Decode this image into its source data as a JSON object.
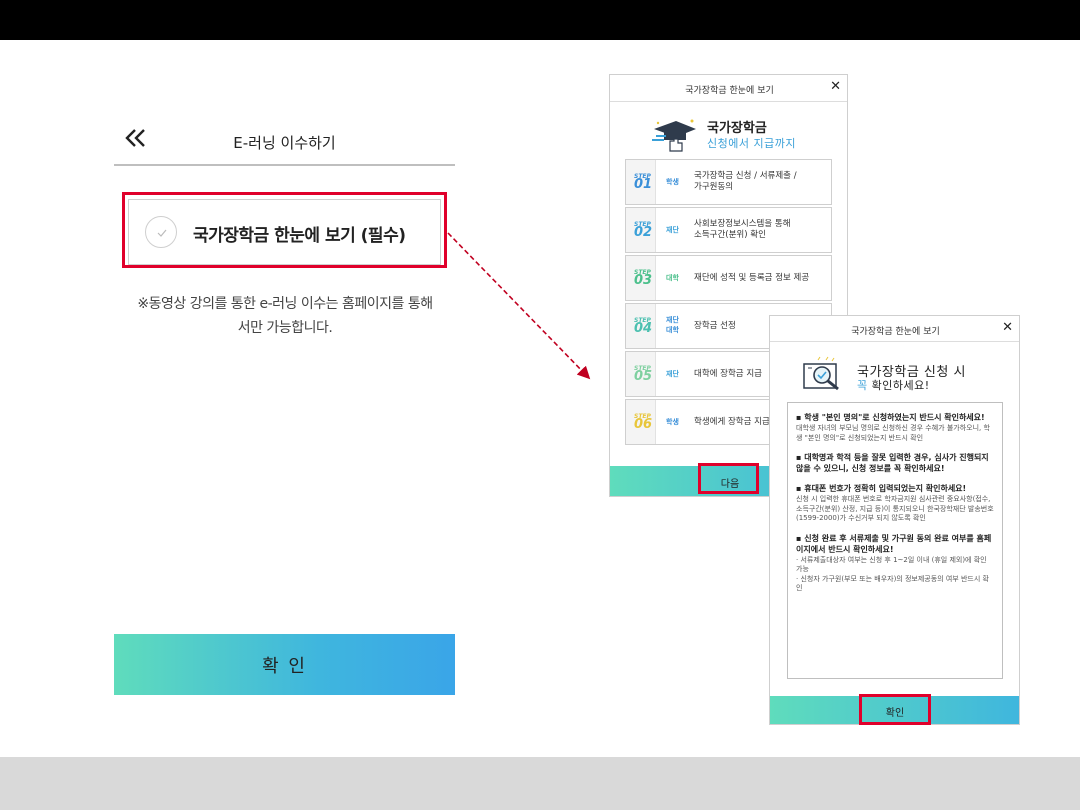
{
  "mobile": {
    "title": "E-러닝 이수하기",
    "option_label": "국가장학금 한눈에 보기 (필수)",
    "notice_line1": "※동영상 강의를 통한 e-러닝 이수는 홈페이지를 통해",
    "notice_line2": "서만 가능합니다.",
    "confirm_label": "확 인"
  },
  "popup1": {
    "title": "국가장학금 한눈에 보기",
    "close": "✕",
    "brand": "국가장학금",
    "brand_sub": "신청에서 지급까지",
    "step_word": "STEP",
    "steps": [
      {
        "num": "01",
        "actor": "학생",
        "actor2": "",
        "text1": "국가장학금 신청 / 서류제출 /",
        "text2": "가구원동의",
        "color": "#3a8fd8"
      },
      {
        "num": "02",
        "actor": "재단",
        "actor2": "",
        "text1": "사회보장정보시스템을 통해",
        "text2": "소득구간(분위) 확인",
        "color": "#3aa0d8"
      },
      {
        "num": "03",
        "actor": "대학",
        "actor2": "",
        "text1": "재단에 성적 및 등록금 정보 제공",
        "text2": "",
        "color": "#4cc08c"
      },
      {
        "num": "04",
        "actor": "재단",
        "actor2": "대학",
        "text1": "장학금 선정",
        "text2": "",
        "color": "#4cc0b0"
      },
      {
        "num": "05",
        "actor": "재단",
        "actor2": "",
        "text1": "대학에 장학금 지급",
        "text2": "",
        "color": "#7fd0a0"
      },
      {
        "num": "06",
        "actor": "학생",
        "actor2": "",
        "text1": "학생에게 장학금 지급",
        "text2": "",
        "color": "#e8c63a"
      }
    ],
    "next_label": "다음"
  },
  "popup2": {
    "title": "국가장학금 한눈에 보기",
    "close": "✕",
    "brand": "국가장학금 신청 시",
    "brand_sub_hl": "꼭",
    "brand_sub": " 확인하세요!",
    "items": [
      {
        "head": "▪ 학생 \"본인 명의\"로 신청하였는지 반드시 확인하세요!",
        "body": "대학생 자녀의 부모님 명의로 신청하신 경우 수혜가 불가하오니, 학생 \"본인 명의\"로 신청되었는지 반드시 확인"
      },
      {
        "head": "▪ 대학명과 학적 등을 잘못 입력한 경우, 심사가 진행되지 않을 수 있으니, 신청 정보를 꼭 확인하세요!",
        "body": ""
      },
      {
        "head": "▪ 휴대폰 번호가 정확히 입력되었는지 확인하세요!",
        "body": "신청 시 입력한 휴대폰 번호로 학자금지원 심사관련 중요사항(접수, 소득구간(분위) 산정, 지급 등)이 통지되오니 한국장학재단 발송번호(1599-2000)가 수신거부 되지 않도록 확인"
      },
      {
        "head": "▪ 신청 완료 후 서류제출 및 가구원 동의 완료 여부를 홈페이지에서 반드시 확인하세요!",
        "body": "· 서류제출대상자 여부는 신청 후 1~2일 이내 (휴일 제외)에 확인 가능\n· 신청자 가구원(부모 또는 배우자)의 정보제공동의 여부 반드시 확인"
      }
    ],
    "confirm_label": "확인"
  },
  "colors": {
    "highlight_red": "#e0002b",
    "gradient_start": "#5fdcbc",
    "gradient_end": "#3aa5e8",
    "accent_blue": "#3aa0d8"
  }
}
